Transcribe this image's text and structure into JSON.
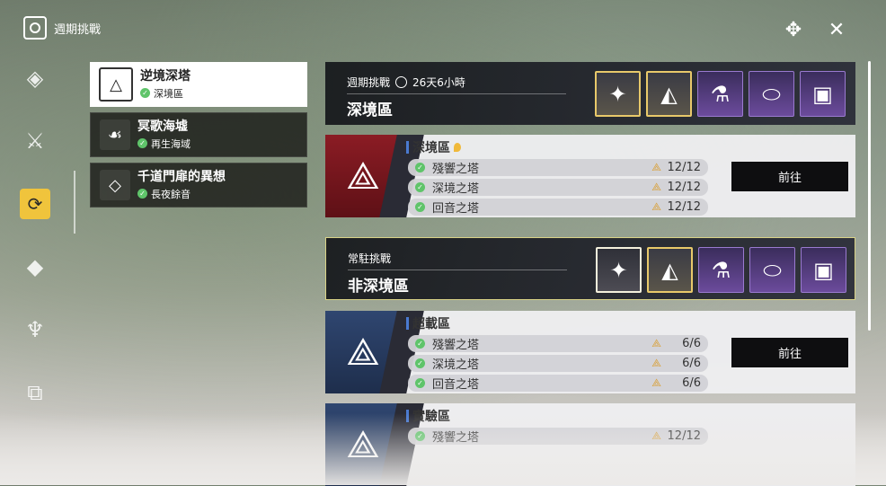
{
  "header": {
    "title": "週期挑戰"
  },
  "rail": [
    "compass-star-icon",
    "crossed-swords-icon",
    "weekly-challenge-icon",
    "mask-icon",
    "demon-icon",
    "door-icon"
  ],
  "categories": [
    {
      "name": "逆境深塔",
      "sub": "深境區",
      "icon": "triangle-emblem-icon",
      "active": true
    },
    {
      "name": "冥歌海墟",
      "sub": "再生海域",
      "icon": "wave-beast-icon",
      "active": false
    },
    {
      "name": "千道門扉的異想",
      "sub": "長夜餘音",
      "icon": "gate-diamond-icon",
      "active": false
    }
  ],
  "weekly": {
    "label": "週期挑戰",
    "time": "26天6小時",
    "title": "深境區"
  },
  "permanent": {
    "label": "常駐挑戰",
    "title": "非深境區"
  },
  "zones": [
    {
      "name": "深境區",
      "towers": [
        {
          "name": "殘響之塔",
          "count": "12/12"
        },
        {
          "name": "深境之塔",
          "count": "12/12"
        },
        {
          "name": "回音之塔",
          "count": "12/12"
        }
      ],
      "button": "前往"
    },
    {
      "name": "超載區",
      "towers": [
        {
          "name": "殘響之塔",
          "count": "6/6"
        },
        {
          "name": "深境之塔",
          "count": "6/6"
        },
        {
          "name": "回音之塔",
          "count": "6/6"
        }
      ],
      "button": "前往"
    },
    {
      "name": "實驗區",
      "towers": [
        {
          "name": "殘響之塔",
          "count": "12/12"
        }
      ]
    }
  ],
  "colors": {
    "accent": "#f0c43c",
    "check": "#5fc46a",
    "gold_border": "#e8c96a"
  }
}
